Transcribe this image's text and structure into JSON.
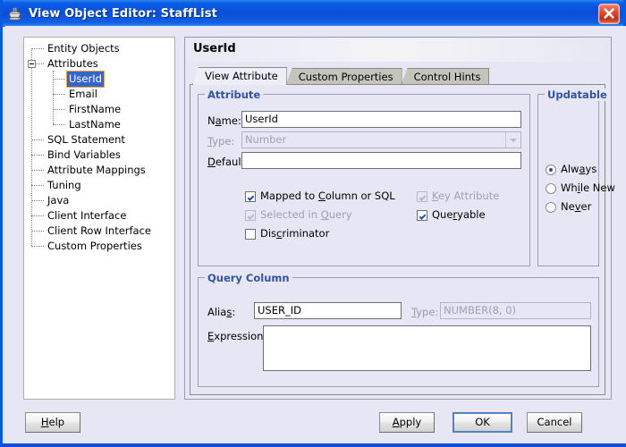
{
  "window": {
    "title": "View Object Editor: StaffList",
    "icon": "java-coffee-cup-icon",
    "close_label": "×",
    "titlebar_color": "#0b4fd8",
    "background_color": "#e6e6f5"
  },
  "tree": {
    "name": "navigation-tree",
    "selected": "UserId",
    "items": [
      {
        "label": "Entity Objects",
        "level": 0,
        "expander": "none"
      },
      {
        "label": "Attributes",
        "level": 0,
        "expander": "minus"
      },
      {
        "label": "UserId",
        "level": 1,
        "expander": "none",
        "selected": true
      },
      {
        "label": "Email",
        "level": 1,
        "expander": "none"
      },
      {
        "label": "FirstName",
        "level": 1,
        "expander": "none"
      },
      {
        "label": "LastName",
        "level": 1,
        "expander": "none"
      },
      {
        "label": "SQL Statement",
        "level": 0,
        "expander": "none"
      },
      {
        "label": "Bind Variables",
        "level": 0,
        "expander": "none"
      },
      {
        "label": "Attribute Mappings",
        "level": 0,
        "expander": "none"
      },
      {
        "label": "Tuning",
        "level": 0,
        "expander": "none"
      },
      {
        "label": "Java",
        "level": 0,
        "expander": "none"
      },
      {
        "label": "Client Interface",
        "level": 0,
        "expander": "none"
      },
      {
        "label": "Client Row Interface",
        "level": 0,
        "expander": "none"
      },
      {
        "label": "Custom Properties",
        "level": 0,
        "expander": "none"
      }
    ]
  },
  "page": {
    "title": "UserId",
    "tabs": [
      {
        "label": "View Attribute",
        "active": true
      },
      {
        "label": "Custom Properties",
        "active": false
      },
      {
        "label": "Control Hints",
        "active": false
      }
    ]
  },
  "attribute_group": {
    "title": "Attribute",
    "name_label": "Name:",
    "name_value": "UserId",
    "type_label": "Type:",
    "type_value": "Number",
    "type_disabled": true,
    "default_label": "Default:",
    "default_value": "",
    "checkboxes": [
      {
        "label": "Mapped to Column or SQL",
        "checked": true,
        "disabled": false
      },
      {
        "label": "Selected in Query",
        "checked": true,
        "disabled": true
      },
      {
        "label": "Discriminator",
        "checked": false,
        "disabled": false
      },
      {
        "label": "Key Attribute",
        "checked": true,
        "disabled": true
      },
      {
        "label": "Queryable",
        "checked": true,
        "disabled": false
      }
    ]
  },
  "updatable_group": {
    "title": "Updatable",
    "options": [
      {
        "label": "Always",
        "selected": true
      },
      {
        "label": "While New",
        "selected": false
      },
      {
        "label": "Never",
        "selected": false
      }
    ]
  },
  "query_column_group": {
    "title": "Query Column",
    "alias_label": "Alias:",
    "alias_value": "USER_ID",
    "type_label": "Type:",
    "type_value": "NUMBER(8, 0)",
    "type_disabled": true,
    "expression_label": "Expression:",
    "expression_value": ""
  },
  "buttons": {
    "help": "Help",
    "apply": "Apply",
    "ok": "OK",
    "cancel": "Cancel"
  }
}
